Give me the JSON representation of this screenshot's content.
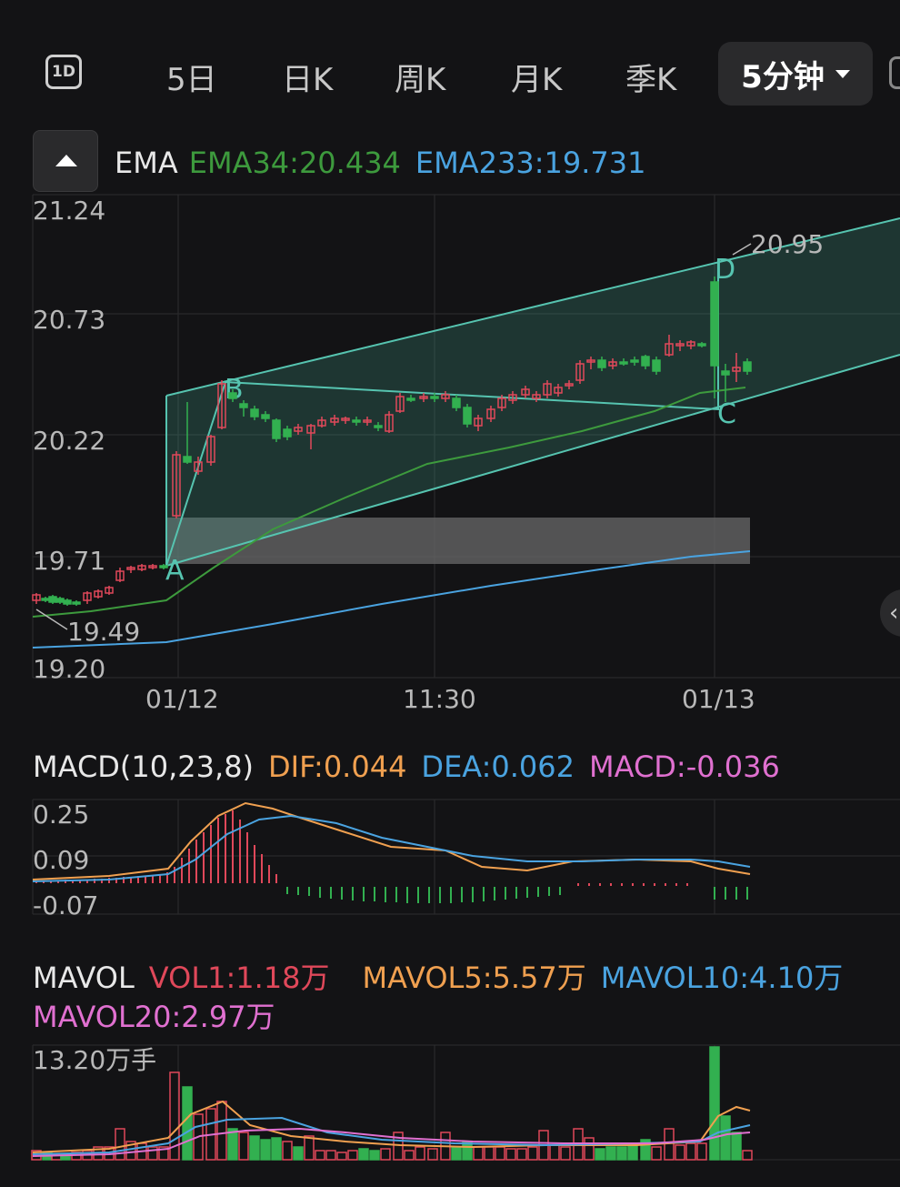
{
  "tabs": {
    "icon_label": "1D",
    "items": [
      "5日",
      "日K",
      "周K",
      "月K",
      "季K"
    ],
    "active": "5分钟"
  },
  "ema": {
    "name": "EMA",
    "ema34": "EMA34:20.434",
    "ema233": "EMA233:19.731",
    "color_ema34": "#3d9a3d",
    "color_ema233": "#4aa3e0"
  },
  "macd": {
    "name": "MACD(10,23,8)",
    "dif": "DIF:0.044",
    "dea": "DEA:0.062",
    "macd": "MACD:-0.036",
    "color_dif": "#f0a050",
    "color_dea": "#4aa3e0",
    "color_macd": "#e070d0"
  },
  "vol": {
    "name": "MAVOL",
    "vol1": "VOL1:1.18万",
    "mavol5": "MAVOL5:5.57万",
    "mavol10": "MAVOL10:4.10万",
    "mavol20": "MAVOL20:2.97万",
    "color_vol1": "#e0485a",
    "color_mavol5": "#f0a050",
    "color_mavol10": "#4aa3e0",
    "color_mavol20": "#e070d0"
  },
  "chart_data": [
    {
      "type": "candlestick",
      "title": "EMA",
      "y_ticks": [
        "21.24",
        "20.73",
        "20.22",
        "19.71",
        "19.20"
      ],
      "ylim": [
        19.2,
        21.24
      ],
      "x_ticks": [
        "01/12",
        "11:30",
        "01/13"
      ],
      "annotations": {
        "high": "20.95",
        "low": "19.49"
      },
      "pattern_points": [
        "A",
        "B",
        "C",
        "D"
      ],
      "colors": {
        "up": "#e0485a",
        "down": "#32b050",
        "channel": "#56c4b0"
      },
      "series": [
        {
          "name": "EMA34",
          "values": [
            19.47,
            19.48,
            19.5,
            19.53,
            19.57,
            19.62,
            19.79,
            19.88,
            19.95,
            20.01,
            20.06,
            20.1,
            20.14,
            20.17,
            20.22,
            20.27,
            20.31,
            20.37,
            20.41,
            20.43
          ]
        },
        {
          "name": "EMA233",
          "values": [
            19.33,
            19.335,
            19.34,
            19.35,
            19.38,
            19.41,
            19.44,
            19.47,
            19.5,
            19.53,
            19.56,
            19.59,
            19.62,
            19.65,
            19.68,
            19.71,
            19.73
          ]
        }
      ]
    },
    {
      "type": "bar",
      "title": "MACD(10,23,8)",
      "y_ticks": [
        "0.25",
        "0.09",
        "-0.07"
      ],
      "ylim": [
        -0.07,
        0.25
      ],
      "series": [
        {
          "name": "DIF",
          "values": [
            0.04,
            0.05,
            0.06,
            0.07,
            0.08,
            0.2,
            0.26,
            0.23,
            0.2,
            0.17,
            0.16,
            0.15,
            0.13,
            0.11,
            0.1,
            0.1,
            0.11,
            0.11,
            0.1,
            0.08,
            0.044
          ]
        },
        {
          "name": "DEA",
          "values": [
            0.04,
            0.045,
            0.05,
            0.06,
            0.07,
            0.13,
            0.2,
            0.23,
            0.21,
            0.19,
            0.17,
            0.16,
            0.15,
            0.13,
            0.11,
            0.1,
            0.1,
            0.1,
            0.1,
            0.09,
            0.062
          ]
        },
        {
          "name": "MACD",
          "values": [
            0.01,
            0.01,
            0.02,
            0.03,
            0.06,
            0.12,
            0.08,
            0.02,
            -0.01,
            -0.03,
            -0.04,
            -0.04,
            -0.03,
            -0.02,
            -0.01,
            0.01,
            0.01,
            0.01,
            0.0,
            -0.02,
            -0.036
          ]
        }
      ]
    },
    {
      "type": "bar",
      "title": "MAVOL",
      "y_ticks": [
        "13.20万手"
      ],
      "ylim": [
        0,
        13.2
      ],
      "series": [
        {
          "name": "VOL1",
          "values": [
            1.2,
            1.0,
            1.5,
            2.5,
            2.0,
            10.5,
            8.5,
            6.0,
            5.5,
            4.5,
            3.5,
            2.5,
            2.0,
            2.0,
            2.5,
            1.5,
            1.5,
            2.0,
            1.5,
            2.0,
            2.5,
            1.8,
            2.0,
            13.2,
            6.5,
            1.18
          ]
        },
        {
          "name": "MAVOL5",
          "values": [
            1.2,
            1.5,
            2.0,
            3.5,
            5.5,
            6.5,
            5.5,
            4.5,
            3.5,
            3.0,
            2.5,
            2.2,
            2.0,
            2.0,
            2.0,
            2.2,
            2.4,
            5.0,
            5.57
          ]
        },
        {
          "name": "MAVOL10",
          "values": [
            1.0,
            1.2,
            1.6,
            2.5,
            4.0,
            4.5,
            4.4,
            3.8,
            3.0,
            2.6,
            2.4,
            2.3,
            2.2,
            2.1,
            2.0,
            2.1,
            2.3,
            3.2,
            4.1
          ]
        },
        {
          "name": "MAVOL20",
          "values": [
            0.9,
            1.0,
            1.2,
            1.8,
            2.8,
            3.4,
            3.5,
            3.3,
            3.0,
            2.8,
            2.6,
            2.5,
            2.4,
            2.3,
            2.2,
            2.2,
            2.3,
            2.7,
            2.97
          ]
        }
      ]
    }
  ]
}
